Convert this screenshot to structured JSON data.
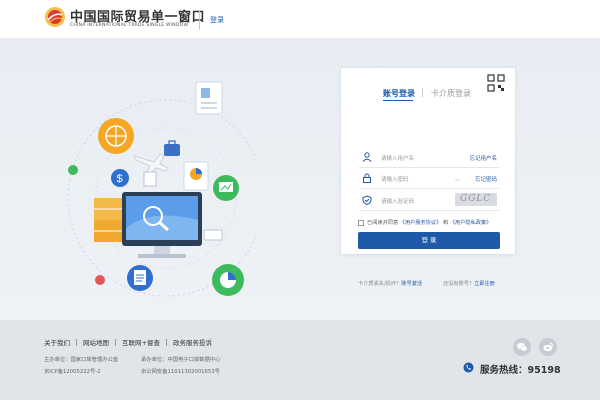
{
  "header": {
    "title": "中国国际贸易单一窗口",
    "subtitle": "CHINA INTERNATIONAL TRADE SINGLE WINDOW",
    "login_link": "登录"
  },
  "login": {
    "tab_account": "账号登录",
    "tab_card": "卡介质登录",
    "username_placeholder": "请输入用户名",
    "forgot_username": "忘记用户名",
    "password_placeholder": "请输入密码",
    "forgot_password": "忘记密码",
    "captcha_placeholder": "请输入验证码",
    "captcha_text": "GGLC",
    "agree_prefix": "已阅读并同意",
    "agree_terms": "《用户服务协议》",
    "agree_and": "和",
    "agree_privacy": "《用户隐私政策》",
    "button": "登 录",
    "card_lost_prefix": "卡介质丢失/损坏？",
    "card_lost_link": "账号激活",
    "no_account_prefix": "还没有账号？",
    "register_link": "立即注册"
  },
  "footer": {
    "links": [
      "关于我们",
      "网站地图",
      "互联网+督查",
      "政务服务投诉"
    ],
    "host_line": "主办单位：国家口岸管理办公室",
    "undertake_line": "承办单位：中国电子口岸数据中心",
    "icp": "京ICP备12005222号-2",
    "police": "京公网安备11011302001653号",
    "hotline_label": "服务热线：",
    "hotline_number": "95198"
  },
  "colors": {
    "primary": "#1e5aa8",
    "banner_bg": "#eaeef3",
    "footer_bg": "#e1e4e8"
  }
}
